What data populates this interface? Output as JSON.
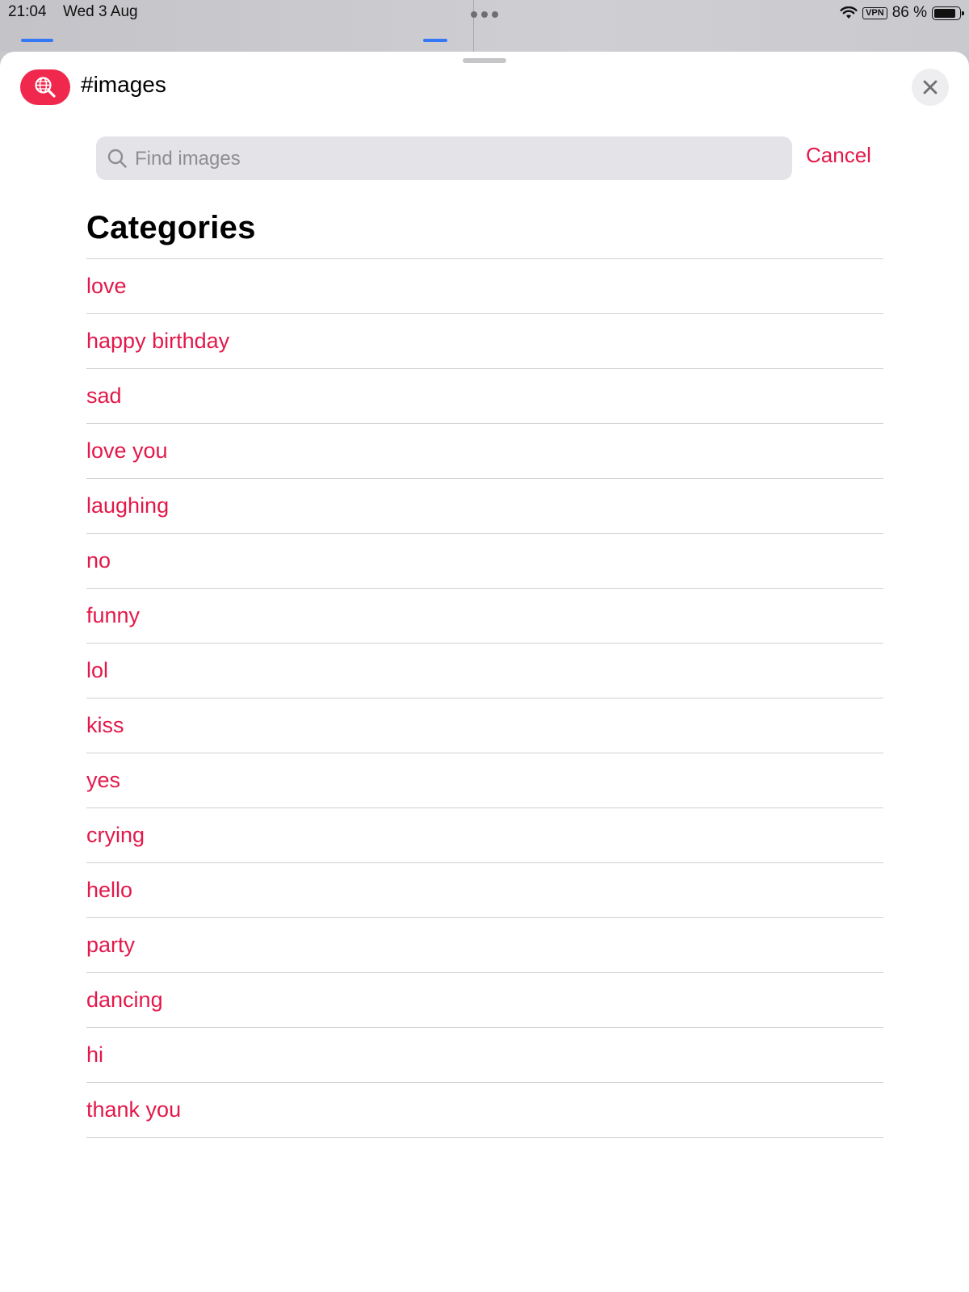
{
  "status_bar": {
    "time": "21:04",
    "date": "Wed 3 Aug",
    "vpn_label": "VPN",
    "battery_percent_label": "86 %",
    "battery_level": 0.86,
    "icons": [
      "multitask-dots-icon",
      "wifi-icon",
      "battery-icon"
    ]
  },
  "sheet": {
    "app_icon": "globe-search-icon",
    "title": "#images",
    "close_icon": "close-icon"
  },
  "search": {
    "placeholder": "Find images",
    "value": "",
    "icon": "search-icon",
    "cancel_label": "Cancel"
  },
  "categories": {
    "title": "Categories",
    "items": [
      {
        "label": "love"
      },
      {
        "label": "happy birthday"
      },
      {
        "label": "sad"
      },
      {
        "label": "love you"
      },
      {
        "label": "laughing"
      },
      {
        "label": "no"
      },
      {
        "label": "funny"
      },
      {
        "label": "lol"
      },
      {
        "label": "kiss"
      },
      {
        "label": "yes"
      },
      {
        "label": "crying"
      },
      {
        "label": "hello"
      },
      {
        "label": "party"
      },
      {
        "label": "dancing"
      },
      {
        "label": "hi"
      },
      {
        "label": "thank you"
      }
    ]
  },
  "colors": {
    "accent": "#e3184a",
    "icon_background": "#f0284e",
    "search_background": "#e3e3e8",
    "separator": "#d1d1d6",
    "background_app_tint": "#3478f6"
  }
}
